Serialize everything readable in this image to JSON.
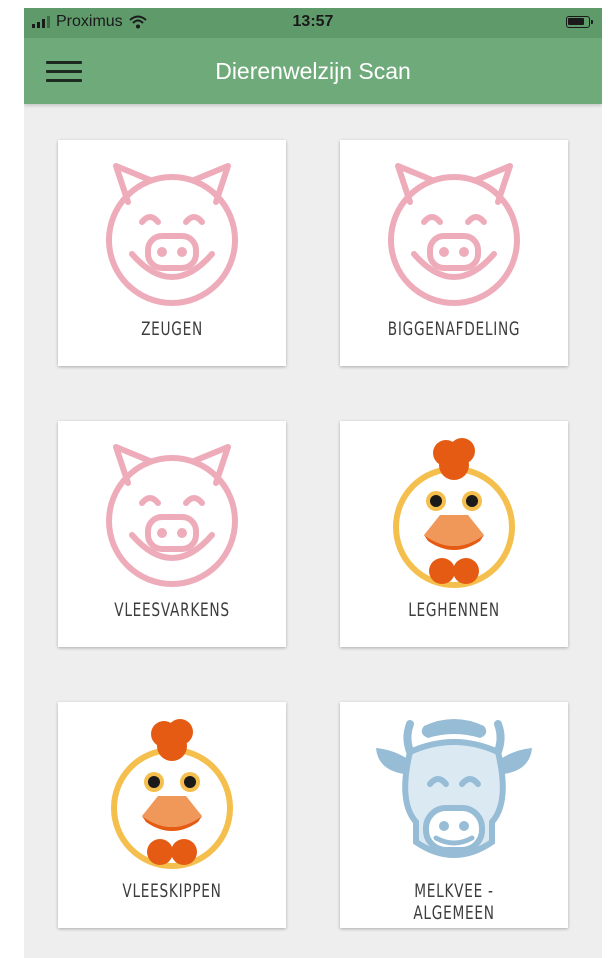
{
  "status_bar": {
    "carrier": "Proximus",
    "time": "13:57"
  },
  "app_bar": {
    "title": "Dierenwelzijn Scan"
  },
  "tiles": [
    {
      "label": "ZEUGEN",
      "icon": "pig-icon"
    },
    {
      "label": "BIGGENAFDELING",
      "icon": "pig-icon"
    },
    {
      "label": "VLEESVARKENS",
      "icon": "pig-icon"
    },
    {
      "label": "LEGHENNEN",
      "icon": "chicken-icon"
    },
    {
      "label": "VLEESKIPPEN",
      "icon": "chicken-icon"
    },
    {
      "label": "MELKVEE - ALGEMEEN",
      "icon": "cow-icon"
    }
  ],
  "colors": {
    "app_bar": "#6faa7b",
    "pig": "#eeacba",
    "chicken_ring": "#f4bf4d",
    "chicken_accent": "#e55b13",
    "cow": "#96bcd6",
    "background": "#eeeeee"
  }
}
